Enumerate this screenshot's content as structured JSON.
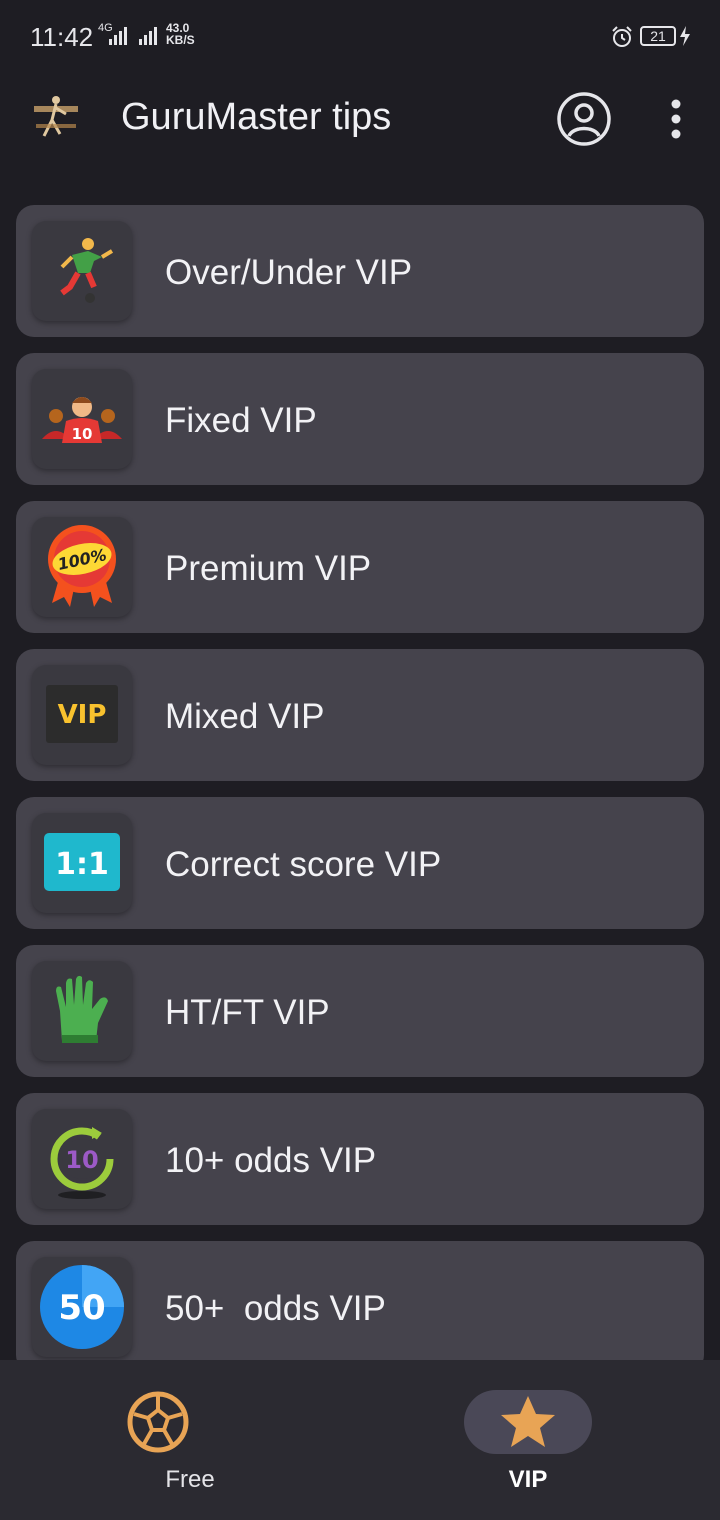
{
  "status_bar": {
    "time": "11:42",
    "network": "4G",
    "speed_value": "43.0",
    "speed_unit": "KB/S",
    "battery": "21"
  },
  "app_bar": {
    "title": "GuruMaster tips",
    "logo_icon": "soccer-logo-icon",
    "actions": [
      "account-icon",
      "more-vert-icon"
    ]
  },
  "list": {
    "items": [
      {
        "label": "Over/Under VIP",
        "icon": "soccer-player-icon"
      },
      {
        "label": "Fixed VIP",
        "icon": "team-players-icon"
      },
      {
        "label": "Premium VIP",
        "icon": "100-percent-ribbon-icon"
      },
      {
        "label": "Mixed VIP",
        "icon": "vip-badge-icon"
      },
      {
        "label": "Correct score VIP",
        "icon": "score-1-1-icon"
      },
      {
        "label": "HT/FT VIP",
        "icon": "goalkeeper-glove-icon"
      },
      {
        "label": "10+ odds VIP",
        "icon": "ten-timer-icon"
      },
      {
        "label": "50+  odds VIP",
        "icon": "fifty-badge-icon"
      }
    ]
  },
  "icon_text": {
    "jersey_number": "10",
    "ribbon_text": "100%",
    "vip_text": "VIP",
    "score_text": "1:1",
    "ten_text": "10",
    "fifty_text": "50"
  },
  "bottom_nav": {
    "items": [
      {
        "label": "Free",
        "icon": "soccer-ball-icon",
        "active": false
      },
      {
        "label": "VIP",
        "icon": "star-icon",
        "active": true
      }
    ]
  },
  "colors": {
    "background": "#1e1d23",
    "card": "#45434c",
    "accent_orange": "#e8a455",
    "active_pill": "#4a4857"
  }
}
